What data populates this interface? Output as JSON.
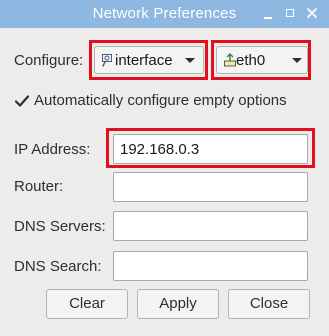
{
  "window": {
    "title": "Network Preferences"
  },
  "configure": {
    "label": "Configure:",
    "type_value": "interface",
    "device_value": "eth0"
  },
  "auto_configure": {
    "label": "Automatically configure empty options",
    "checked": true
  },
  "fields": {
    "ip_address": {
      "label": "IP Address:",
      "value": "192.168.0.3"
    },
    "router": {
      "label": "Router:",
      "value": ""
    },
    "dns_servers": {
      "label": "DNS Servers:",
      "value": ""
    },
    "dns_search": {
      "label": "DNS Search:",
      "value": ""
    }
  },
  "buttons": {
    "clear": "Clear",
    "apply": "Apply",
    "close": "Close"
  },
  "colors": {
    "titlebar": "#8eb7e1",
    "highlight": "#e0101e",
    "window_bg": "#edeceb"
  },
  "icons": {
    "interface": "network-interface-icon",
    "device": "ethernet-icon"
  }
}
